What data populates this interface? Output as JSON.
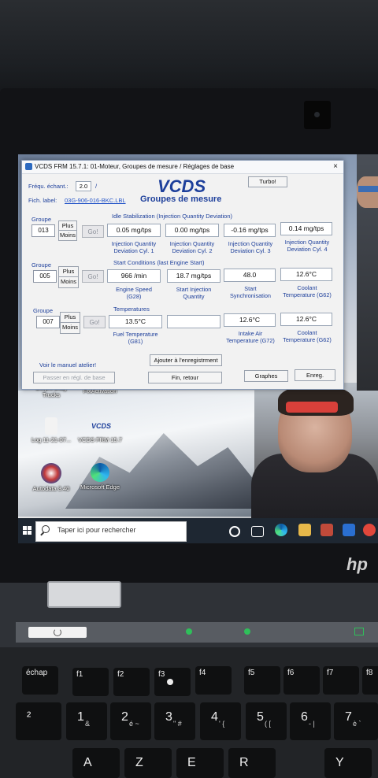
{
  "vcds": {
    "title": "VCDS FRM 15.7.1: 01-Moteur,  Groupes de mesure / Réglages de base",
    "close_label": "×",
    "frequency_label": "Fréqu. échant.:",
    "frequency_value": "2.0",
    "frequency_unit": "/",
    "file_label": "Fich. label:",
    "file_value": "03G-906-016-BKC.LBL",
    "logo": "VCDS",
    "heading": "Groupes de mesure",
    "turbo_label": "Turbo!",
    "groups": [
      {
        "group_label": "Groupe",
        "number": "013",
        "plus_label": "Plus",
        "minus_label": "Moins",
        "go_label": "Go!",
        "section_title": "Idle Stabilization (Injection Quantity Deviation)",
        "values": [
          "0.05 mg/tps",
          "0.00 mg/tps",
          "-0.16 mg/tps",
          "0.14 mg/tps"
        ],
        "descriptions": [
          "Injection Quantity\nDeviation Cyl. 1",
          "Injection Quantity\nDeviation Cyl. 2",
          "Injection Quantity\nDeviation Cyl. 3",
          "Injection Quantity\nDeviation Cyl. 4"
        ]
      },
      {
        "group_label": "Groupe",
        "number": "005",
        "plus_label": "Plus",
        "minus_label": "Moins",
        "go_label": "Go!",
        "section_title": "Start Conditions (last Engine Start)",
        "values": [
          "966 /min",
          "18.7 mg/tps",
          "48.0",
          "12.6°C"
        ],
        "descriptions": [
          "Engine Speed\n(G28)",
          "Start Injection\nQuantity",
          "Start\nSynchronisation",
          "Coolant\nTemperature (G62)"
        ]
      },
      {
        "group_label": "Groupe",
        "number": "007",
        "plus_label": "Plus",
        "minus_label": "Moins",
        "go_label": "Go!",
        "section_title": "Temperatures",
        "values": [
          "13.5°C",
          "",
          "12.6°C",
          "12.6°C"
        ],
        "descriptions": [
          "Fuel Temperature\n(G81)",
          "",
          "Intake Air\nTemperature (G72)",
          "Coolant\nTemperature (G62)"
        ]
      }
    ],
    "manual_link": "Voir le manuel atelier!",
    "record_button": "Ajouter à l'enregistrment",
    "basic_settings_button": "Passer en régl. de base",
    "finish_button": "Fin, retour",
    "graphs_button": "Graphes",
    "save_button": "Enreg."
  },
  "desktop": {
    "icons": [
      {
        "label": "Delphi Diag\nTrucks",
        "name": "delphi-diag-trucks-icon"
      },
      {
        "label": "FixActivation",
        "name": "fixactivation-icon"
      },
      {
        "label": "Log 11-21-07...",
        "name": "log-file-icon"
      },
      {
        "label": "VCDS FRM 15.7",
        "name": "vcds-shortcut-icon",
        "glyph_text": "VCDS"
      },
      {
        "label": "Autodata 3.40",
        "name": "autodata-icon"
      },
      {
        "label": "Microsoft Edge",
        "name": "microsoft-edge-icon"
      }
    ]
  },
  "taskbar": {
    "search_placeholder": "Taper ici pour rechercher"
  },
  "laptop": {
    "brand": "hp",
    "keys": [
      {
        "main": "échap",
        "sub": ""
      },
      {
        "main": "f1",
        "sub": ""
      },
      {
        "main": "f2",
        "sub": ""
      },
      {
        "main": "f3",
        "sub": ""
      },
      {
        "main": "f4",
        "sub": ""
      },
      {
        "main": "f5",
        "sub": ""
      },
      {
        "main": "f6",
        "sub": ""
      },
      {
        "main": "f7",
        "sub": ""
      },
      {
        "main": "f8",
        "sub": ""
      },
      {
        "main": "²",
        "sub": ""
      },
      {
        "main": "1",
        "sub": "&"
      },
      {
        "main": "2",
        "sub": "é ~"
      },
      {
        "main": "3",
        "sub": "\" #"
      },
      {
        "main": "4",
        "sub": "' {"
      },
      {
        "main": "5",
        "sub": "( ["
      },
      {
        "main": "6",
        "sub": "- |"
      },
      {
        "main": "7",
        "sub": "è `"
      },
      {
        "main": "A",
        "sub": ""
      },
      {
        "main": "Z",
        "sub": ""
      },
      {
        "main": "E",
        "sub": ""
      },
      {
        "main": "R",
        "sub": ""
      },
      {
        "main": "Y",
        "sub": ""
      }
    ]
  },
  "colors": {
    "vcds_blue": "#1d3f9b",
    "window_bg": "#f2f2f2",
    "taskbar": "#1e2732"
  }
}
